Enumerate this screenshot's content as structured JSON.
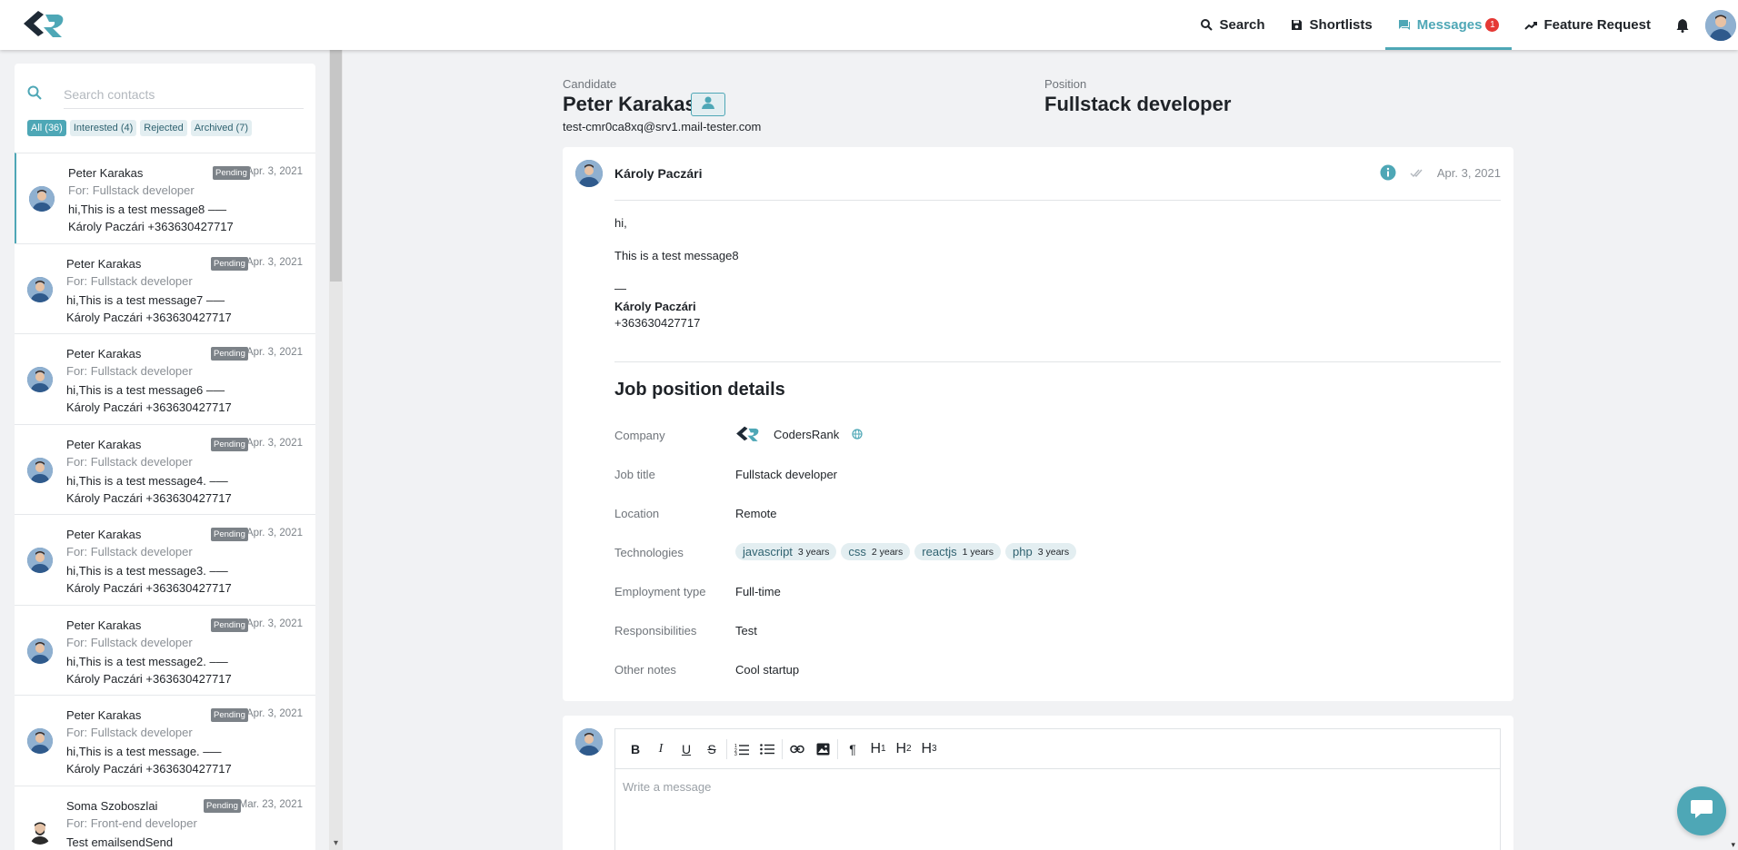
{
  "nav": {
    "search": "Search",
    "shortlists": "Shortlists",
    "messages": "Messages",
    "messages_badge": "1",
    "feature_request": "Feature Request"
  },
  "sidebar": {
    "search_placeholder": "Search contacts",
    "filters": [
      "All (36)",
      "Interested (4)",
      "Rejected",
      "Archived (7)"
    ],
    "contacts": [
      {
        "name": "Peter Karakas",
        "status": "Pending",
        "date": "Apr. 3, 2021",
        "for": "For: Fullstack developer",
        "preview": "hi,This is a test message8 –— Károly Paczári +363630427717"
      },
      {
        "name": "Peter Karakas",
        "status": "Pending",
        "date": "Apr. 3, 2021",
        "for": "For: Fullstack developer",
        "preview": "hi,This is a test message7 –— Károly Paczári +363630427717"
      },
      {
        "name": "Peter Karakas",
        "status": "Pending",
        "date": "Apr. 3, 2021",
        "for": "For: Fullstack developer",
        "preview": "hi,This is a test message6  –— Károly Paczári +363630427717"
      },
      {
        "name": "Peter Karakas",
        "status": "Pending",
        "date": "Apr. 3, 2021",
        "for": "For: Fullstack developer",
        "preview": "hi,This is a test message4.  –— Károly Paczári +363630427717"
      },
      {
        "name": "Peter Karakas",
        "status": "Pending",
        "date": "Apr. 3, 2021",
        "for": "For: Fullstack developer",
        "preview": "hi,This is a test message3.  –— Károly Paczári +363630427717"
      },
      {
        "name": "Peter Karakas",
        "status": "Pending",
        "date": "Apr. 3, 2021",
        "for": "For: Fullstack developer",
        "preview": "hi,This is a test message2.  –— Károly Paczári +363630427717"
      },
      {
        "name": "Peter Karakas",
        "status": "Pending",
        "date": "Apr. 3, 2021",
        "for": "For: Fullstack developer",
        "preview": "hi,This is a test message.  –— Károly Paczári +363630427717"
      },
      {
        "name": "Soma Szoboszlai",
        "status": "Pending",
        "date": "Mar. 23, 2021",
        "for": "For: Front-end developer",
        "preview": "Test emailsendSend"
      }
    ]
  },
  "header": {
    "candidate_label": "Candidate",
    "candidate_name": "Peter Karakas",
    "candidate_email": "test-cmr0ca8xq@srv1.mail-tester.com",
    "position_label": "Position",
    "position_name": "Fullstack developer"
  },
  "message": {
    "sender": "Károly Paczári",
    "date": "Apr. 3, 2021",
    "greeting": "hi,",
    "body": "This is a test message8",
    "signature_sep": "—",
    "signature_name": "Károly Paczári",
    "signature_phone": "+363630427717"
  },
  "job": {
    "title": "Job position details",
    "labels": {
      "company": "Company",
      "job_title": "Job title",
      "location": "Location",
      "technologies": "Technologies",
      "employment_type": "Employment type",
      "responsibilities": "Responsibilities",
      "other_notes": "Other notes"
    },
    "company": "CodersRank",
    "job_title": "Fullstack developer",
    "location": "Remote",
    "technologies": [
      {
        "name": "javascript",
        "years": "3 years"
      },
      {
        "name": "css",
        "years": "2 years"
      },
      {
        "name": "reactjs",
        "years": "1 years"
      },
      {
        "name": "php",
        "years": "3 years"
      }
    ],
    "employment_type": "Full-time",
    "responsibilities": "Test",
    "other_notes": "Cool startup"
  },
  "composer": {
    "placeholder": "Write a message",
    "toolbar": [
      "B",
      "I",
      "U",
      "S",
      "ordered-list",
      "bullet-list",
      "link",
      "image",
      "¶",
      "H1",
      "H2",
      "H3"
    ]
  },
  "colors": {
    "accent": "#4ea7b6",
    "badge": "#e53935",
    "pending": "#7c8288"
  }
}
